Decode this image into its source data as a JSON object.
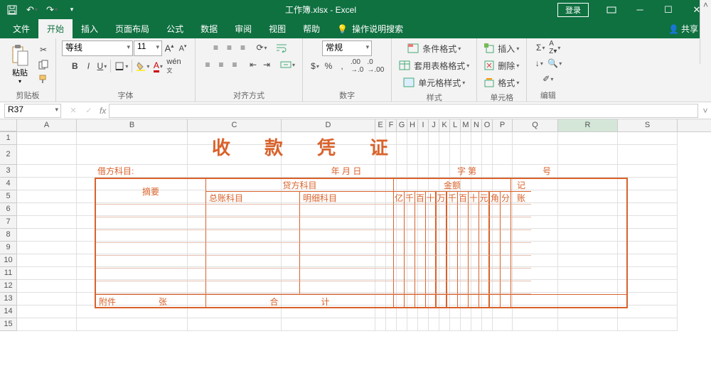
{
  "title": "工作簿.xlsx - Excel",
  "win": {
    "login": "登录"
  },
  "menu": {
    "file": "文件",
    "home": "开始",
    "insert": "插入",
    "layout": "页面布局",
    "formula": "公式",
    "data": "数据",
    "review": "审阅",
    "view": "视图",
    "help": "帮助",
    "tell": "操作说明搜索",
    "share": "共享"
  },
  "ribbon": {
    "paste": "粘贴",
    "clipboard": "剪贴板",
    "font_name": "等线",
    "font_size": "11",
    "font": "字体",
    "align": "对齐方式",
    "number_fmt": "常规",
    "number": "数字",
    "cond_fmt": "条件格式",
    "tbl_fmt": "套用表格格式",
    "cell_style": "单元格样式",
    "styles": "样式",
    "insert": "插入",
    "delete": "删除",
    "format": "格式",
    "cells": "单元格",
    "edit": "编辑"
  },
  "namebox": "R37",
  "fx": "fx",
  "cols": [
    "A",
    "B",
    "C",
    "D",
    "E",
    "F",
    "G",
    "H",
    "I",
    "J",
    "K",
    "L",
    "M",
    "N",
    "O",
    "P",
    "Q",
    "R",
    "S"
  ],
  "voucher": {
    "title": "收款凭证",
    "debit_subj": "借方科目:",
    "date": "年   月   日",
    "zi": "字",
    "di": "第",
    "hao": "号",
    "summary": "摘要",
    "credit_subj": "贷方科目",
    "amount": "金额",
    "ji": "记",
    "zhang": "账",
    "gl": "总账科目",
    "detail": "明细科目",
    "units": [
      "亿",
      "千",
      "百",
      "十",
      "万",
      "千",
      "百",
      "十",
      "元",
      "角",
      "分"
    ],
    "attach": "附件",
    "zhang2": "张",
    "heji": "合",
    "ji2": "计"
  }
}
